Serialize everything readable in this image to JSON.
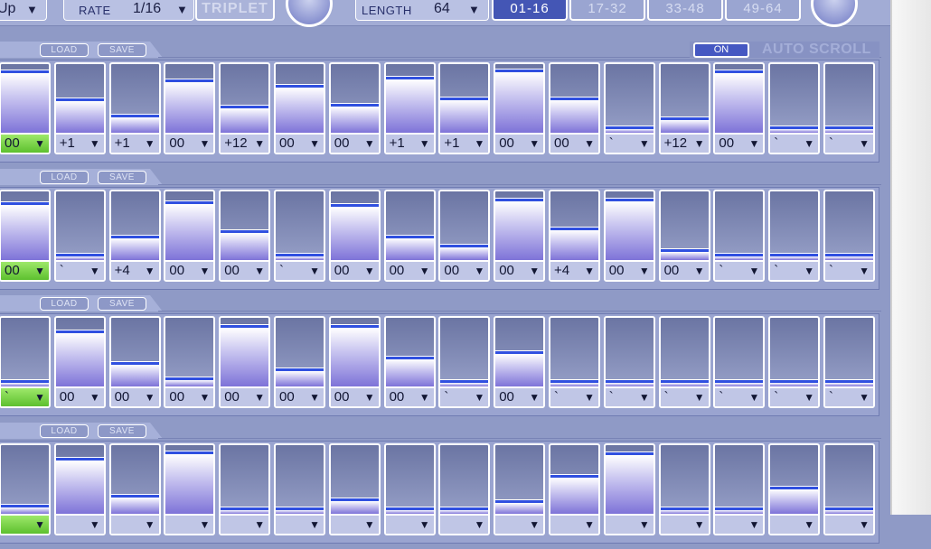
{
  "toolbar": {
    "direction_value": "Up",
    "rate_label": "RATE",
    "rate_value": "1/16",
    "triplet_label": "TRIPLET",
    "length_label": "LENGTH",
    "length_value": "64",
    "pages": [
      "01-16",
      "17-32",
      "33-48",
      "49-64"
    ],
    "active_page": 0,
    "arrow": "▼"
  },
  "auto_scroll": {
    "on_label": "ON",
    "label": "AUTO SCROLL"
  },
  "lanes": [
    {
      "load": "LOAD",
      "save": "SAVE",
      "steps": [
        {
          "label": "00",
          "level": 0.92,
          "green": true
        },
        {
          "label": "+1",
          "level": 0.48
        },
        {
          "label": "+1",
          "level": 0.24
        },
        {
          "label": "00",
          "level": 0.78
        },
        {
          "label": "+12",
          "level": 0.38
        },
        {
          "label": "00",
          "level": 0.7
        },
        {
          "label": "00",
          "level": 0.4
        },
        {
          "label": "+1",
          "level": 0.82
        },
        {
          "label": "+1",
          "level": 0.5
        },
        {
          "label": "00",
          "level": 0.93
        },
        {
          "label": "00",
          "level": 0.5
        },
        {
          "label": "`",
          "level": 0.05
        },
        {
          "label": "+12",
          "level": 0.2
        },
        {
          "label": "00",
          "level": 0.92
        },
        {
          "label": "`",
          "level": 0.05
        },
        {
          "label": "`",
          "level": 0.05
        }
      ]
    },
    {
      "load": "LOAD",
      "save": "SAVE",
      "steps": [
        {
          "label": "00",
          "level": 0.85,
          "green": true
        },
        {
          "label": "`",
          "level": 0.06
        },
        {
          "label": "+4",
          "level": 0.33
        },
        {
          "label": "00",
          "level": 0.86
        },
        {
          "label": "00",
          "level": 0.42
        },
        {
          "label": "`",
          "level": 0.06
        },
        {
          "label": "00",
          "level": 0.82
        },
        {
          "label": "00",
          "level": 0.33
        },
        {
          "label": "00",
          "level": 0.2
        },
        {
          "label": "00",
          "level": 0.9
        },
        {
          "label": "+4",
          "level": 0.46
        },
        {
          "label": "00",
          "level": 0.9
        },
        {
          "label": "00",
          "level": 0.12
        },
        {
          "label": "`",
          "level": 0.06
        },
        {
          "label": "`",
          "level": 0.06
        },
        {
          "label": "`",
          "level": 0.06
        }
      ]
    },
    {
      "load": "LOAD",
      "save": "SAVE",
      "steps": [
        {
          "label": "`",
          "level": 0.06,
          "green": true
        },
        {
          "label": "00",
          "level": 0.82
        },
        {
          "label": "00",
          "level": 0.34
        },
        {
          "label": "00",
          "level": 0.1
        },
        {
          "label": "00",
          "level": 0.9
        },
        {
          "label": "00",
          "level": 0.24
        },
        {
          "label": "00",
          "level": 0.9
        },
        {
          "label": "00",
          "level": 0.42
        },
        {
          "label": "`",
          "level": 0.06
        },
        {
          "label": "00",
          "level": 0.5
        },
        {
          "label": "`",
          "level": 0.06
        },
        {
          "label": "`",
          "level": 0.06
        },
        {
          "label": "`",
          "level": 0.06
        },
        {
          "label": "`",
          "level": 0.06
        },
        {
          "label": "`",
          "level": 0.06
        },
        {
          "label": "`",
          "level": 0.06
        }
      ]
    },
    {
      "load": "LOAD",
      "save": "SAVE",
      "steps": [
        {
          "label": "",
          "level": 0.1,
          "green": true
        },
        {
          "label": "",
          "level": 0.82
        },
        {
          "label": "",
          "level": 0.25
        },
        {
          "label": "",
          "level": 0.92
        },
        {
          "label": "",
          "level": 0.06
        },
        {
          "label": "",
          "level": 0.06
        },
        {
          "label": "",
          "level": 0.2
        },
        {
          "label": "",
          "level": 0.06
        },
        {
          "label": "",
          "level": 0.06
        },
        {
          "label": "",
          "level": 0.16
        },
        {
          "label": "",
          "level": 0.56
        },
        {
          "label": "",
          "level": 0.9
        },
        {
          "label": "",
          "level": 0.06
        },
        {
          "label": "",
          "level": 0.06
        },
        {
          "label": "",
          "level": 0.38
        },
        {
          "label": "",
          "level": 0.06
        }
      ]
    }
  ]
}
